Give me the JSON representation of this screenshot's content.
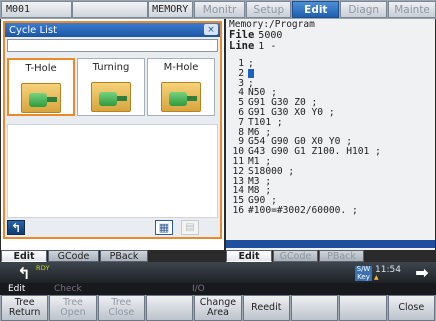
{
  "topbar": {
    "machine": "M001",
    "mode": "MEMORY",
    "tabs": [
      {
        "label": "Monitr",
        "active": false
      },
      {
        "label": "Setup",
        "active": false
      },
      {
        "label": "Edit",
        "active": true
      },
      {
        "label": "Diagn",
        "active": false
      },
      {
        "label": "Mainte",
        "active": false
      }
    ]
  },
  "cycle_list": {
    "title": "Cycle List",
    "close_icon": "×",
    "items": [
      {
        "label": "T-Hole",
        "selected": true
      },
      {
        "label": "Turning",
        "selected": false
      },
      {
        "label": "M-Hole",
        "selected": false
      }
    ],
    "back_icon": "↰",
    "grid_icon": "▦",
    "list_icon": "▤"
  },
  "program": {
    "path": "Memory:/Program",
    "file_label": "File",
    "file_value": "5000",
    "line_label": "Line",
    "line_value": "1 -",
    "lines": [
      {
        "n": "1",
        "text": ";"
      },
      {
        "n": "2",
        "text": ""
      },
      {
        "n": "3",
        "text": ";"
      },
      {
        "n": "4",
        "text": "N50 ;"
      },
      {
        "n": "5",
        "text": "G91 G30 Z0 ;"
      },
      {
        "n": "6",
        "text": "G91 G30 X0 Y0 ;"
      },
      {
        "n": "7",
        "text": "T101 ;"
      },
      {
        "n": "8",
        "text": "M6 ;"
      },
      {
        "n": "9",
        "text": "G54 G90 G0 X0 Y0 ;"
      },
      {
        "n": "10",
        "text": "G43 G90 G1 Z100. H101 ;"
      },
      {
        "n": "11",
        "text": "M1 ;"
      },
      {
        "n": "12",
        "text": "S18000 ;"
      },
      {
        "n": "13",
        "text": "M3 ;"
      },
      {
        "n": "14",
        "text": "M8 ;"
      },
      {
        "n": "15",
        "text": "G90 ;"
      },
      {
        "n": "16",
        "text": "#100=#3002/60000. ;"
      }
    ]
  },
  "window_tabs_left": [
    {
      "label": "Edit",
      "state": "active"
    },
    {
      "label": "GCode",
      "state": "normal"
    },
    {
      "label": "PBack",
      "state": "normal"
    }
  ],
  "window_tabs_right": [
    {
      "label": "Edit",
      "state": "active"
    },
    {
      "label": "GCode",
      "state": "dim"
    },
    {
      "label": "PBack",
      "state": "dim"
    }
  ],
  "status": {
    "back_icon": "↰",
    "rdy": "RDY",
    "sw_key": "S/W Key",
    "time": "11:54",
    "next_icon": "➡"
  },
  "menu_head": {
    "edit": "Edit",
    "check": "Check",
    "io": "I/O"
  },
  "softkeys": [
    {
      "l1": "Tree",
      "l2": "Return",
      "state": "normal"
    },
    {
      "l1": "Tree",
      "l2": "Open",
      "state": "disabled"
    },
    {
      "l1": "Tree",
      "l2": "Close",
      "state": "disabled"
    },
    {
      "l1": "",
      "l2": "",
      "state": "empty"
    },
    {
      "l1": "Change",
      "l2": "Area",
      "state": "normal"
    },
    {
      "l1": "Reedit",
      "l2": "",
      "state": "normal"
    },
    {
      "l1": "",
      "l2": "",
      "state": "empty"
    },
    {
      "l1": "",
      "l2": "",
      "state": "empty"
    },
    {
      "l1": "Close",
      "l2": "",
      "state": "normal"
    }
  ]
}
